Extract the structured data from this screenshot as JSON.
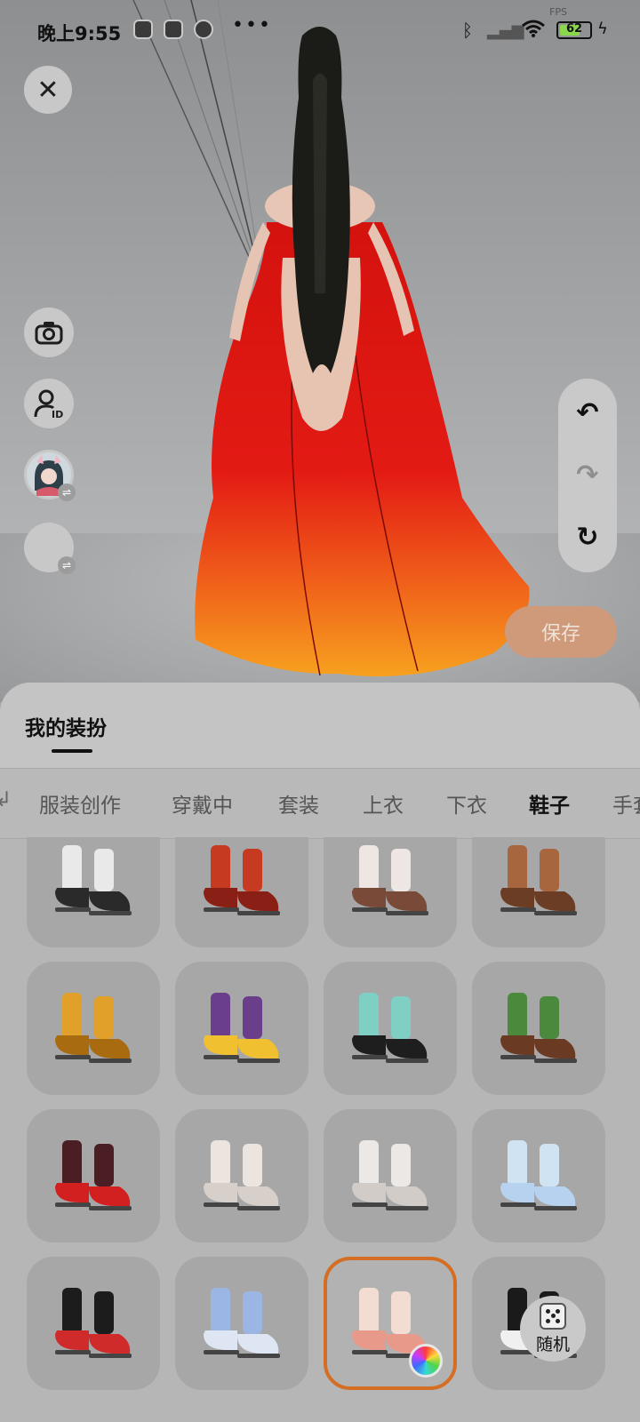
{
  "status_bar": {
    "time": "晚上9:55",
    "fps_label": "FPS",
    "battery": "62",
    "icons": [
      "camera-app-icon",
      "tiktok-icon",
      "browser-icon",
      "more-dots-icon",
      "bluetooth-icon",
      "signal-icon",
      "wifi-icon",
      "battery-icon",
      "charging-icon"
    ]
  },
  "side_controls": {
    "close": "✕",
    "camera_icon": "camera-icon",
    "id_icon": "user-id-icon",
    "swap_symbol": "⇌"
  },
  "history_controls": {
    "undo": "↶",
    "redo": "↷",
    "reset": "↻"
  },
  "save_label": "保存",
  "sheet": {
    "title": "我的装扮",
    "tabs": [
      {
        "label": "服装创作",
        "active": false
      },
      {
        "label": "穿戴中",
        "active": false
      },
      {
        "label": "套装",
        "active": false
      },
      {
        "label": "上衣",
        "active": false
      },
      {
        "label": "下衣",
        "active": false
      },
      {
        "label": "鞋子",
        "active": true
      },
      {
        "label": "手套",
        "active": false
      }
    ],
    "items": [
      {
        "name": "white-socks-black-shoes",
        "colors": [
          "#e9e9ea",
          "#2a2a2a"
        ]
      },
      {
        "name": "red-flat-shoes",
        "colors": [
          "#c73a22",
          "#8a1f15"
        ]
      },
      {
        "name": "white-fluffy-boots",
        "colors": [
          "#ede6e2",
          "#7a4a38"
        ]
      },
      {
        "name": "brown-paw-slippers",
        "colors": [
          "#a7663e",
          "#6a3d24"
        ]
      },
      {
        "name": "yellow-claw-boots",
        "colors": [
          "#e0a02a",
          "#a86b10"
        ]
      },
      {
        "name": "purple-argyle-socks",
        "colors": [
          "#6a3e8a",
          "#f0c030"
        ]
      },
      {
        "name": "teal-pattern-socks",
        "colors": [
          "#7fcfc4",
          "#1e1e1e"
        ]
      },
      {
        "name": "green-striped-boots",
        "colors": [
          "#4b8a3c",
          "#6a3a22"
        ]
      },
      {
        "name": "dark-claw-boots",
        "colors": [
          "#4a1e22",
          "#d22020"
        ]
      },
      {
        "name": "knit-bunny-slippers",
        "colors": [
          "#ece4df",
          "#d7cfc9"
        ]
      },
      {
        "name": "white-bunny-boots",
        "colors": [
          "#ebe8e6",
          "#d2ccc8"
        ]
      },
      {
        "name": "holographic-skates",
        "colors": [
          "#cfe3f3",
          "#b7d2ee"
        ]
      },
      {
        "name": "black-red-bow-boots",
        "colors": [
          "#1c1c1c",
          "#cf2b2b"
        ]
      },
      {
        "name": "blue-ballet-flats",
        "colors": [
          "#9bb6e4",
          "#dfe6f3"
        ]
      },
      {
        "name": "pink-bow-heels",
        "colors": [
          "#f3dcd2",
          "#e89a8a"
        ],
        "selected": true,
        "color_picker": true
      },
      {
        "name": "panda-slippers",
        "colors": [
          "#1a1a1a",
          "#f0f0f0"
        ]
      }
    ],
    "random_label": "随机"
  },
  "accent_colors": {
    "selected_border": "#d46e24",
    "save_button": "#cf9a7a",
    "dress": "#e11c16"
  }
}
